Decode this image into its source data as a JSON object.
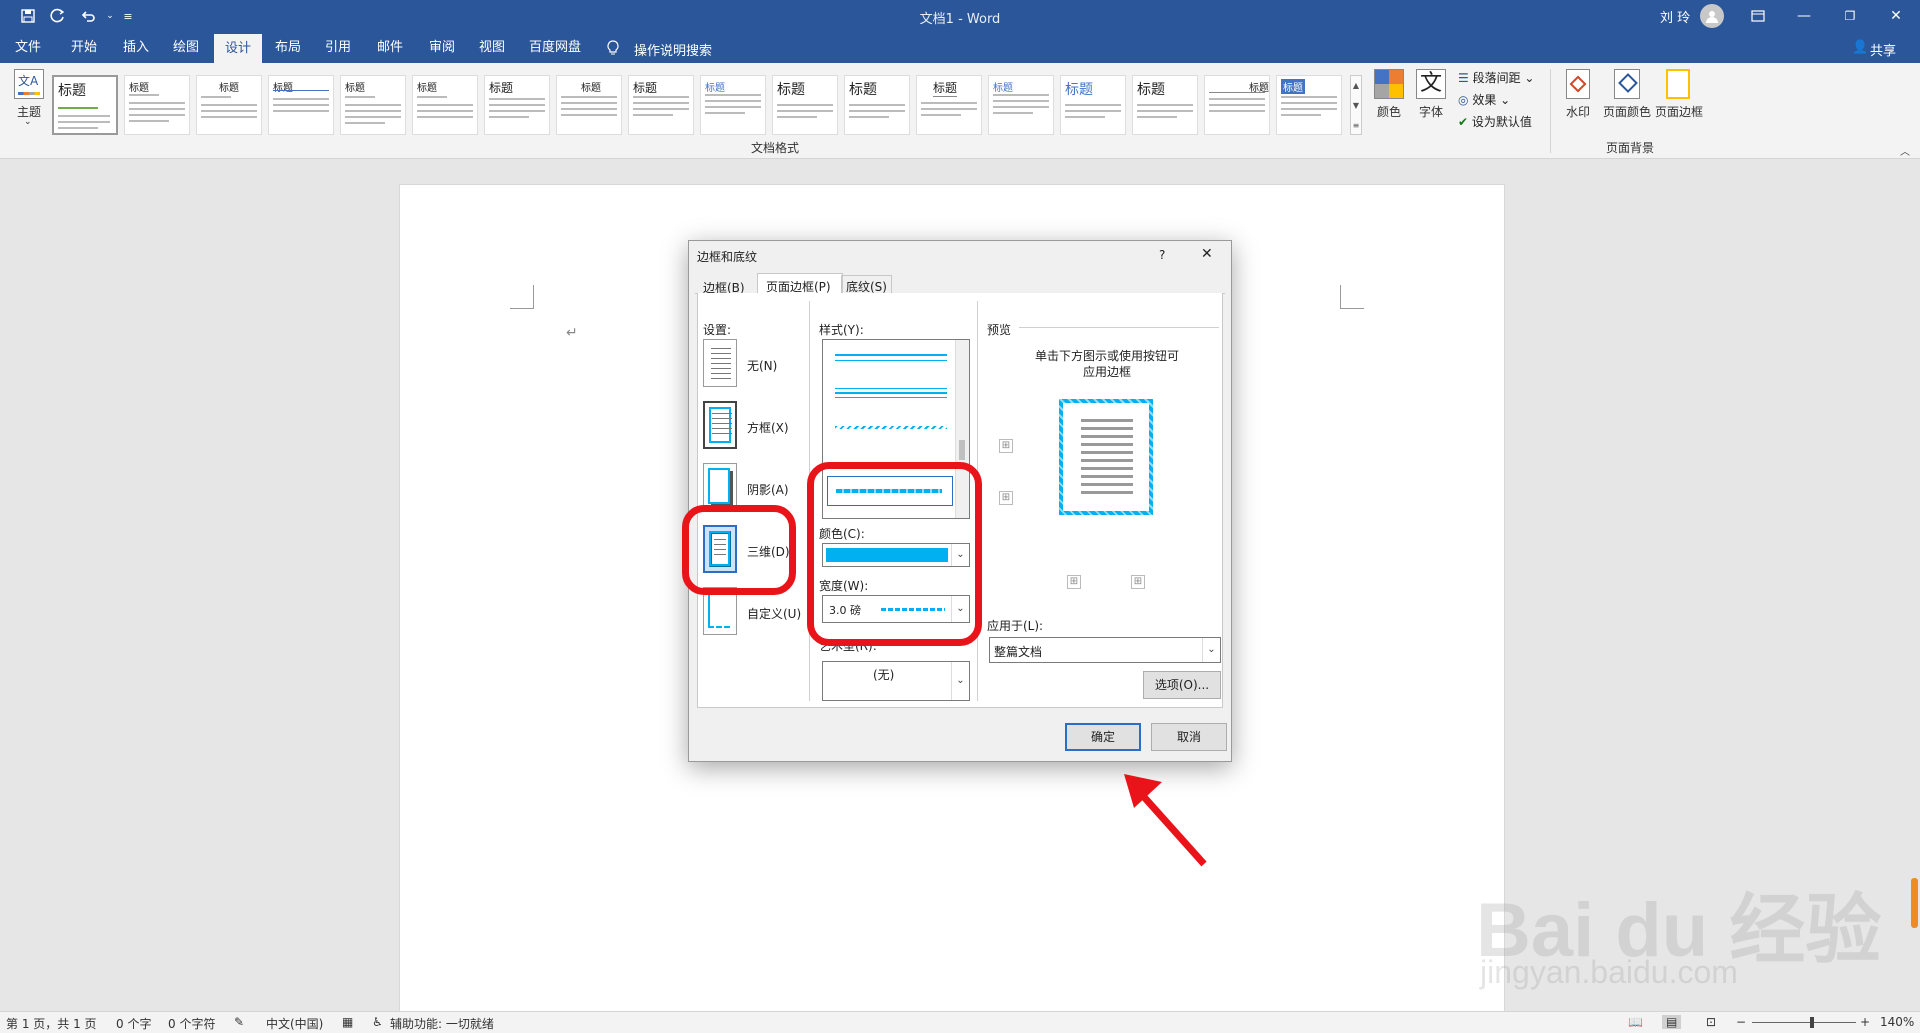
{
  "titlebar": {
    "doc_title": "文档1 - Word",
    "user_name": "刘 玲",
    "icons": [
      "save-icon",
      "autosave-icon",
      "undo-icon",
      "customize-icon",
      "avatar",
      "ribbon-display-icon",
      "minimize-icon",
      "restore-icon",
      "close-icon"
    ]
  },
  "tabs": [
    "文件",
    "开始",
    "插入",
    "绘图",
    "设计",
    "布局",
    "引用",
    "邮件",
    "审阅",
    "视图",
    "百度网盘"
  ],
  "active_tab": "设计",
  "tell_me": "操作说明搜索",
  "share": "共享",
  "ribbon": {
    "theme_label": "主题",
    "gallery_title": "标题",
    "gallery_group_label": "文档格式",
    "colors_label": "颜色",
    "fonts_label": "字体",
    "paragraph_spacing": "段落间距",
    "effects": "效果",
    "set_default": "设为默认值",
    "watermark": "水印",
    "page_color": "页面颜色",
    "page_borders": "页面边框",
    "page_bg_group": "页面背景"
  },
  "dialog": {
    "title": "边框和底纹",
    "help": "?",
    "close": "✕",
    "tabs": [
      "边框(B)",
      "页面边框(P)",
      "底纹(S)"
    ],
    "active_tab": "页面边框(P)",
    "setting_label": "设置:",
    "settings": [
      "无(N)",
      "方框(X)",
      "阴影(A)",
      "三维(D)",
      "自定义(U)"
    ],
    "selected_setting": "三维(D)",
    "style_label": "样式(Y):",
    "color_label": "颜色(C):",
    "color_value": "#00b0f0",
    "width_label": "宽度(W):",
    "width_value": "3.0 磅",
    "art_label": "艺术型(R):",
    "art_value": "(无)",
    "preview_label": "预览",
    "preview_hint_1": "单击下方图示或使用按钮可",
    "preview_hint_2": "应用边框",
    "apply_label": "应用于(L):",
    "apply_value": "整篇文档",
    "options_button": "选项(O)...",
    "ok_button": "确定",
    "cancel_button": "取消"
  },
  "statusbar": {
    "page": "第 1 页，共 1 页",
    "words": "0 个字",
    "chars": "0 个字符",
    "language": "中文(中国)",
    "accessibility": "辅助功能: 一切就绪",
    "zoom": "140%"
  },
  "watermark": {
    "brand": "Bai du 经验",
    "url": "jingyan.baidu.com"
  },
  "colors": {
    "word_blue": "#2b579a",
    "accent_cyan": "#00b0f0",
    "highlight_red": "#e8141a",
    "arrow_red": "#e8141a"
  }
}
